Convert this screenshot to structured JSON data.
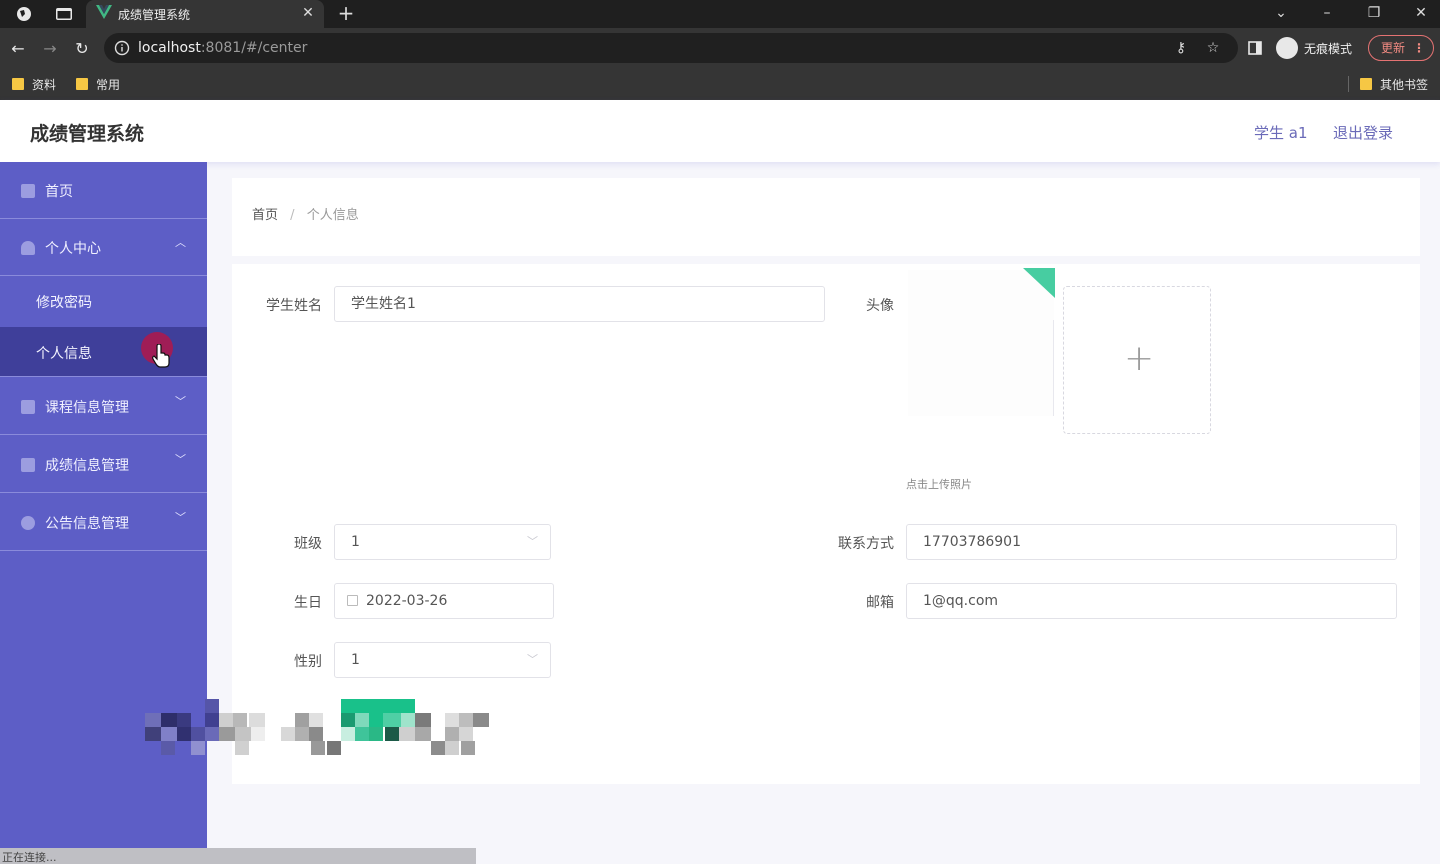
{
  "browser": {
    "tab_title": "成绩管理系统",
    "url_host": "localhost",
    "url_rest": ":8081/#/center",
    "incognito_label": "无痕模式",
    "update_label": "更新",
    "bookmarks": [
      "资料",
      "常用"
    ],
    "other_bookmarks": "其他书签",
    "status_text": "正在连接..."
  },
  "header": {
    "title": "成绩管理系统",
    "user": "学生 a1",
    "logout": "退出登录"
  },
  "sidebar": {
    "home": "首页",
    "personal_center": "个人中心",
    "change_password": "修改密码",
    "personal_info": "个人信息",
    "course_mgmt": "课程信息管理",
    "grade_mgmt": "成绩信息管理",
    "notice_mgmt": "公告信息管理"
  },
  "breadcrumb": {
    "home": "首页",
    "separator": "/",
    "current": "个人信息"
  },
  "form": {
    "name_label": "学生姓名",
    "name_value": "学生姓名1",
    "avatar_label": "头像",
    "upload_hint": "点击上传照片",
    "class_label": "班级",
    "class_value": "1",
    "contact_label": "联系方式",
    "contact_value": "17703786901",
    "birthday_label": "生日",
    "birthday_value": "2022-03-26",
    "email_label": "邮箱",
    "email_value": "1@qq.com",
    "gender_label": "性别",
    "gender_value": "1"
  },
  "colors": {
    "sidebar_bg": "#5d5ec6",
    "sidebar_active": "#3f3f9a",
    "header_link": "#6a6ab8",
    "accent_green": "#19c18a"
  }
}
